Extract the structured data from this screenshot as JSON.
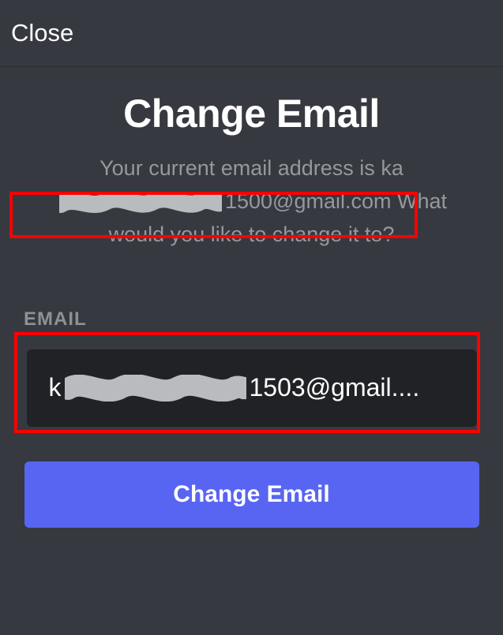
{
  "topbar": {
    "close_label": "Close"
  },
  "title": "Change Email",
  "subtitle": {
    "line1": "Your current email address is ",
    "email_prefix": "ka",
    "email_suffix": "1500@gmail.com",
    "line2_rest": " What would you like to change it to?"
  },
  "form": {
    "email_label": "EMAIL",
    "email_value_prefix": "k",
    "email_value_suffix": "1503@gmail...."
  },
  "button": {
    "primary_label": "Change Email"
  },
  "colors": {
    "brand": "#5865f2",
    "bg": "#36393f",
    "input_bg": "#202225",
    "muted": "#95989d",
    "highlight": "#ff0000"
  }
}
